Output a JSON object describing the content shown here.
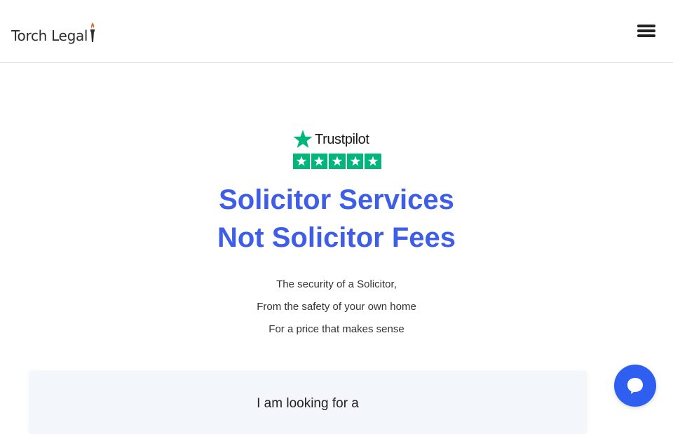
{
  "header": {
    "logo_text": "Torch Legal",
    "menu_icon": "hamburger-menu-icon"
  },
  "trustpilot": {
    "brand": "Trustpilot",
    "rating_stars": 5,
    "star_color": "#00b67a"
  },
  "hero": {
    "headline_line1": "Solicitor Services",
    "headline_line2": "Not Solicitor Fees",
    "subtext": [
      "The security of a Solicitor,",
      "From the safety of your own home",
      "For a price that makes sense"
    ]
  },
  "form": {
    "label": "I am looking for a"
  },
  "chat": {
    "icon": "chat-bubble-icon"
  },
  "colors": {
    "accent": "#3f5ee8",
    "chat_button": "#2f5ff1",
    "torch_flame": "#e8692c",
    "trustpilot_green": "#00b67a"
  }
}
